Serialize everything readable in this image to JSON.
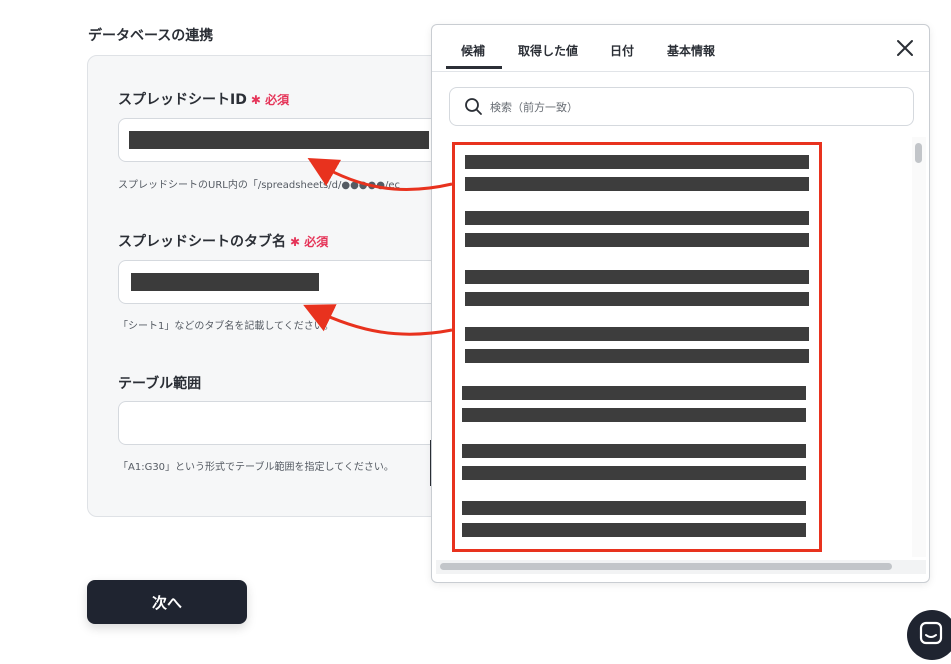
{
  "form": {
    "section_title": "データベースの連携",
    "required_label": "必須",
    "fields": [
      {
        "label": "スプレッドシートID",
        "required": true,
        "help": "スプレッドシートのURL内の「/spreadsheets/d/●●●●●/ec"
      },
      {
        "label": "スプレッドシートのタブ名",
        "required": true,
        "help": "「シート1」などのタブ名を記載してください。"
      },
      {
        "label": "テーブル範囲",
        "required": false,
        "help": "「A1:G30」という形式でテーブル範囲を指定してください。"
      }
    ],
    "next_button": "次へ"
  },
  "popup": {
    "tabs": [
      {
        "label": "候補",
        "active": true
      },
      {
        "label": "取得した値",
        "active": false
      },
      {
        "label": "日付",
        "active": false
      },
      {
        "label": "基本情報",
        "active": false
      }
    ],
    "search_placeholder": "検索（前方一致）",
    "close_icon": "close-icon"
  },
  "colors": {
    "accent": "#e8321e",
    "required": "#e53559",
    "dark_button": "#1f2430"
  }
}
